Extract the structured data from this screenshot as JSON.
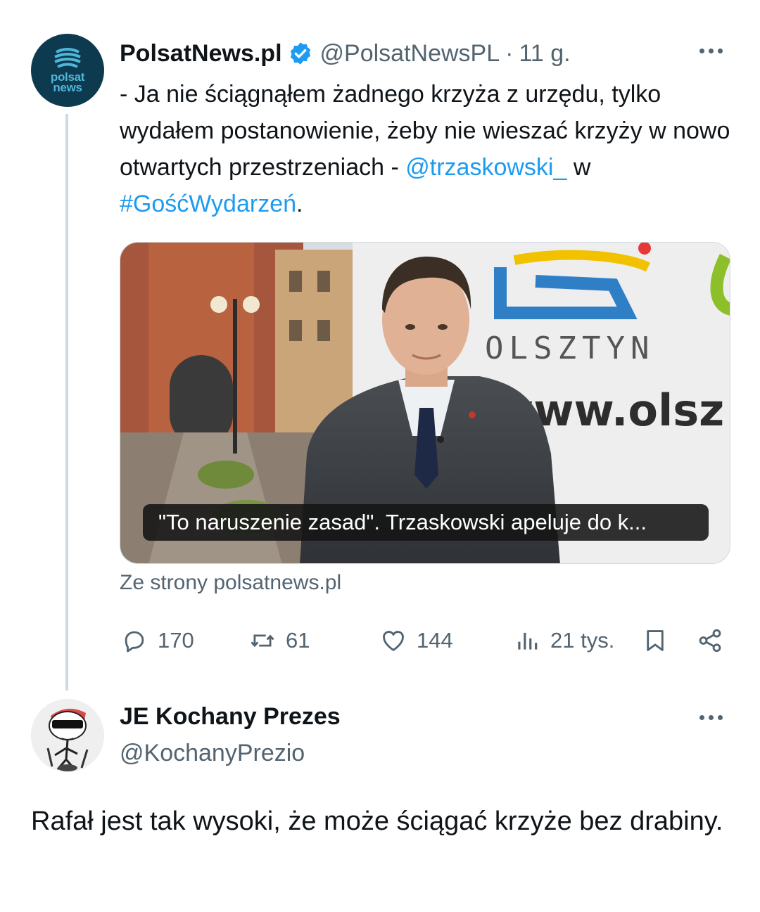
{
  "tweet1": {
    "author_name": "PolsatNews.pl",
    "author_handle": "@PolsatNewsPL",
    "separator": "·",
    "time": "11 g.",
    "avatar_text_line1": "polsat",
    "avatar_text_line2": "news",
    "text_main": "- Ja nie ściągnąłem żadnego krzyża z urzędu, tylko wydałem postanowienie, żeby nie wieszać krzyży w nowo otwartych przestrzeniach - ",
    "mention": "@trzaskowski_",
    "text_mid": " w ",
    "hashtag": "#GośćWydarzeń",
    "text_end": ".",
    "media": {
      "caption": "\"To naruszenie zasad\". Trzaskowski apeluje do k...",
      "backdrop_text_city": "OLSZTYN",
      "backdrop_text_url": "www.olsz"
    },
    "source": "Ze strony polsatnews.pl",
    "actions": {
      "replies": "170",
      "retweets": "61",
      "likes": "144",
      "views": "21 tys."
    },
    "icons": {
      "verified": "verified-badge-icon",
      "more": "more-icon",
      "reply": "reply-icon",
      "retweet": "retweet-icon",
      "like": "heart-icon",
      "views": "views-icon",
      "bookmark": "bookmark-icon",
      "share": "share-icon"
    }
  },
  "tweet2": {
    "author_name": "JE Kochany Prezes",
    "author_handle": "@KochanyPrezio",
    "text": "Rafał jest tak wysoki, że może ściągać krzyże bez drabiny."
  },
  "colors": {
    "link": "#1d9bf0",
    "secondary_text": "#536471",
    "primary_text": "#0f1419",
    "verified": "#1d9bf0"
  }
}
